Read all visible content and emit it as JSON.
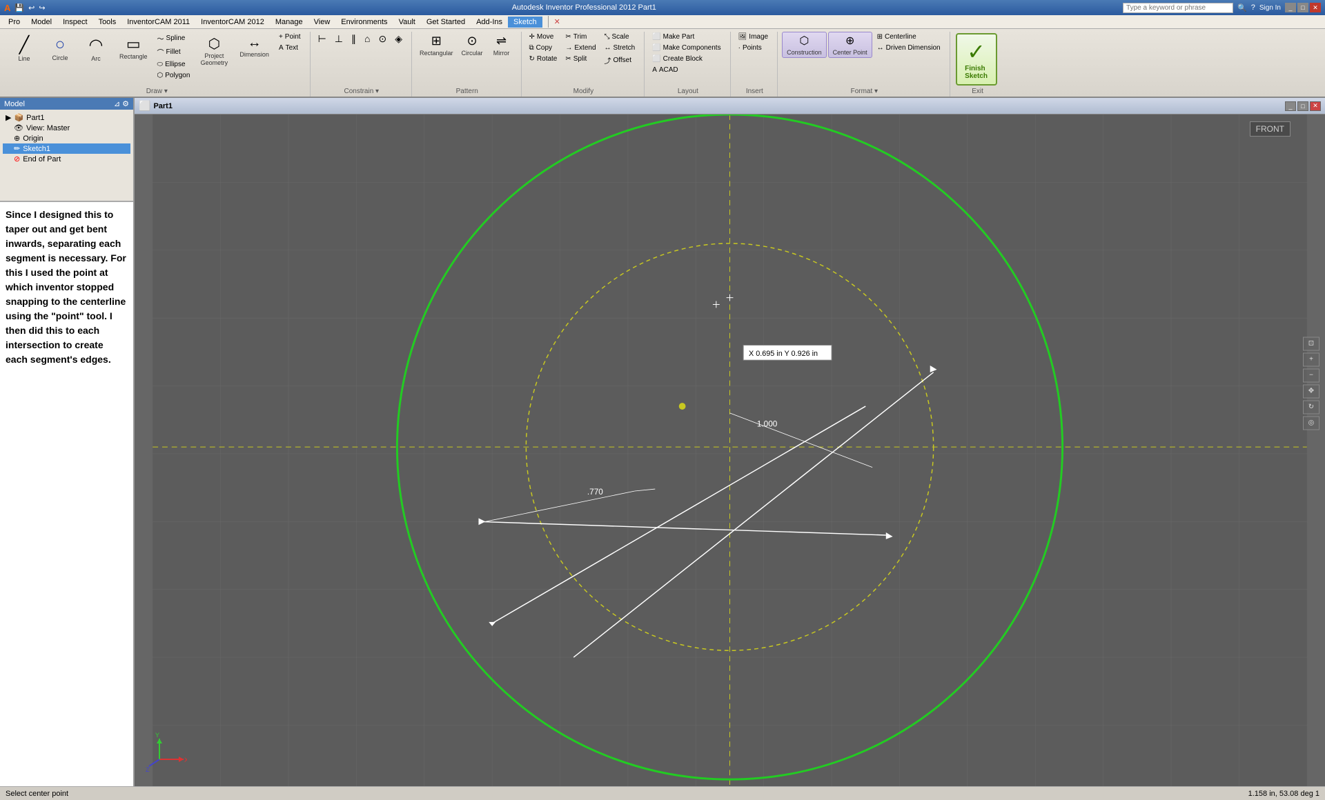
{
  "titlebar": {
    "title": "Autodesk Inventor Professional 2012  Part1",
    "search_placeholder": "Type a keyword or phrase",
    "sign_in": "Sign In"
  },
  "menubar": {
    "items": [
      "Pro",
      "Model",
      "Inspect",
      "Tools",
      "InventorCAM 2011",
      "InventorCAM 2012",
      "Manage",
      "View",
      "Environments",
      "Vault",
      "Get Started",
      "Add-Ins",
      "Sketch",
      "Exit"
    ]
  },
  "ribbon": {
    "active_tab": "Sketch",
    "groups": {
      "draw": {
        "label": "Draw",
        "buttons": [
          {
            "id": "line",
            "label": "Line",
            "icon": "╱"
          },
          {
            "id": "circle",
            "label": "Circle",
            "icon": "○"
          },
          {
            "id": "arc",
            "label": "Arc",
            "icon": "◠"
          },
          {
            "id": "rectangle",
            "label": "Rectangle",
            "icon": "▭"
          },
          {
            "id": "spline",
            "label": "Spline",
            "icon": "~"
          },
          {
            "id": "fillet",
            "label": "Fillet",
            "icon": "⌒"
          },
          {
            "id": "ellipse",
            "label": "Ellipse",
            "icon": "⬭"
          },
          {
            "id": "polygon",
            "label": "Polygon",
            "icon": "⬡"
          },
          {
            "id": "project-geometry",
            "label": "Project Geometry",
            "icon": "⬡"
          },
          {
            "id": "dimension",
            "label": "Dimension",
            "icon": "↔"
          },
          {
            "id": "point",
            "label": "Point",
            "icon": "·"
          },
          {
            "id": "text",
            "label": "Text",
            "icon": "A"
          }
        ]
      },
      "constrain": {
        "label": "Constrain"
      },
      "pattern": {
        "label": "Pattern"
      },
      "modify": {
        "label": "Modify",
        "buttons": [
          {
            "id": "move",
            "label": "Move",
            "icon": "✛"
          },
          {
            "id": "trim",
            "label": "Trim",
            "icon": "✂"
          },
          {
            "id": "scale",
            "label": "Scale",
            "icon": "⤡"
          },
          {
            "id": "copy",
            "label": "Copy",
            "icon": "⧉"
          },
          {
            "id": "extend",
            "label": "Extend",
            "icon": "→"
          },
          {
            "id": "stretch",
            "label": "Stretch",
            "icon": "↔"
          },
          {
            "id": "rotate",
            "label": "Rotate",
            "icon": "↻"
          },
          {
            "id": "split",
            "label": "Split",
            "icon": "✂"
          },
          {
            "id": "mirror",
            "label": "Mirror",
            "icon": "⇌"
          },
          {
            "id": "offset",
            "label": "Offset",
            "icon": "⤴"
          }
        ]
      },
      "layout": {
        "label": "Layout",
        "buttons": [
          {
            "id": "make-part",
            "label": "Make Part",
            "icon": "⬜"
          },
          {
            "id": "make-components",
            "label": "Make Components",
            "icon": "⬜"
          },
          {
            "id": "create-block",
            "label": "Create Block",
            "icon": "⬜"
          },
          {
            "id": "acad",
            "label": "ACAD",
            "icon": "A"
          }
        ]
      },
      "insert": {
        "label": "Insert",
        "buttons": [
          {
            "id": "image",
            "label": "Image",
            "icon": "🖼"
          },
          {
            "id": "points",
            "label": "Points",
            "icon": "·"
          }
        ]
      },
      "format": {
        "label": "Format",
        "buttons": [
          {
            "id": "construction",
            "label": "Construction",
            "icon": "⬡"
          },
          {
            "id": "center-point",
            "label": "Center Point",
            "icon": "⊕"
          },
          {
            "id": "centerline",
            "label": "Centerline",
            "icon": "⊞"
          },
          {
            "id": "driven-dimension",
            "label": "Driven Dimension",
            "icon": "↔"
          }
        ]
      },
      "exit": {
        "label": "Exit",
        "finish_sketch": "Finish Sketch"
      }
    }
  },
  "model_panel": {
    "title": "Model",
    "tree": [
      {
        "label": "Part1",
        "icon": "📦",
        "level": 0
      },
      {
        "label": "View: Master",
        "icon": "👁",
        "level": 1
      },
      {
        "label": "Origin",
        "icon": "⊕",
        "level": 1
      },
      {
        "label": "Sketch1",
        "icon": "✏",
        "level": 1
      },
      {
        "label": "End of Part",
        "icon": "⊘",
        "level": 1
      }
    ]
  },
  "description": "Since I designed this to taper out and get bent inwards, separating each segment is necessary. For this I used the point at which inventor stopped snapping to the centerline using the \"point\" tool. I then did this to each intersection to create each segment's edges.",
  "viewport": {
    "title": "Part1",
    "front_label": "FRONT",
    "coord_x": "X  0.695 in",
    "coord_y": "Y  0.926 in",
    "dim_770": ".770",
    "dim_1000": "1.000"
  },
  "statusbar": {
    "left": "Select center point",
    "right": "1.158 in, 53.08 deg  1"
  }
}
